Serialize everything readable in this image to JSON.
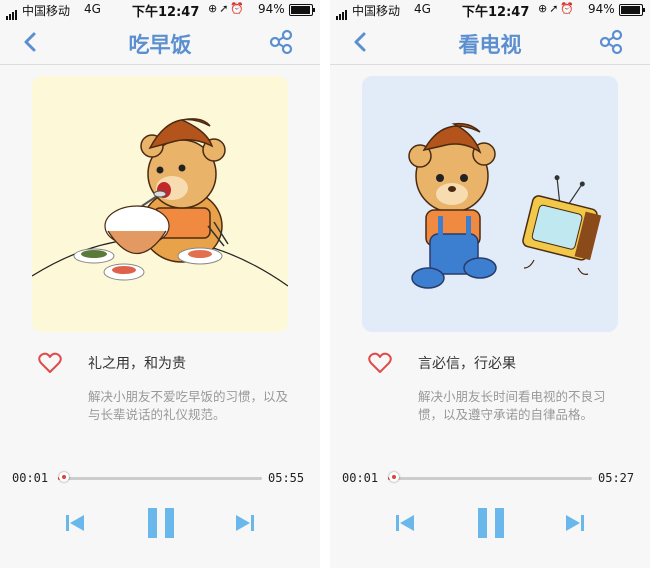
{
  "status_bar": {
    "carrier": "中国移动",
    "network": "4G",
    "time": "下午12:47",
    "battery": "94%"
  },
  "screens": [
    {
      "title": "吃早饭",
      "card_color": "#fdf8d8",
      "subtitle": "礼之用，和为贵",
      "description": "解决小朋友不爱吃早饭的习惯，以及与长辈说话的礼仪规范。",
      "elapsed": "00:01",
      "total": "05:55",
      "progress": 0.03
    },
    {
      "title": "看电视",
      "card_color": "#e1ecf8",
      "subtitle": "言必信，行必果",
      "description": "解决小朋友长时间看电视的不良习惯，以及遵守承诺的自律品格。",
      "elapsed": "00:01",
      "total": "05:27",
      "progress": 0.03
    }
  ],
  "colors": {
    "accent": "#5b8fd0",
    "player_controls": "#6ab7ec",
    "progress": "#e43d3d",
    "heart": "#e04b4b"
  },
  "icons": {
    "back": "chevron-left-icon",
    "share": "share-icon",
    "like": "heart-outline-icon",
    "prev": "skip-previous-icon",
    "play_pause": "pause-icon",
    "next": "skip-next-icon"
  }
}
